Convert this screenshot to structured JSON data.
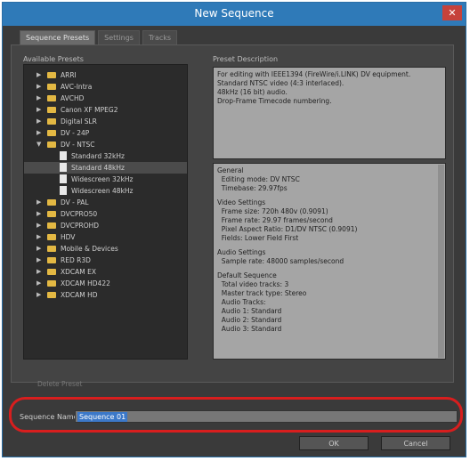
{
  "window": {
    "title": "New Sequence",
    "close_glyph": "✕"
  },
  "tabs": [
    {
      "label": "Sequence Presets",
      "active": true
    },
    {
      "label": "Settings",
      "active": false
    },
    {
      "label": "Tracks",
      "active": false
    }
  ],
  "presets": {
    "label": "Available Presets",
    "items": [
      {
        "label": "ARRI",
        "kind": "folder",
        "expanded": false,
        "depth": 0
      },
      {
        "label": "AVC-Intra",
        "kind": "folder",
        "expanded": false,
        "depth": 0
      },
      {
        "label": "AVCHD",
        "kind": "folder",
        "expanded": false,
        "depth": 0
      },
      {
        "label": "Canon XF MPEG2",
        "kind": "folder",
        "expanded": false,
        "depth": 0
      },
      {
        "label": "Digital SLR",
        "kind": "folder",
        "expanded": false,
        "depth": 0
      },
      {
        "label": "DV - 24P",
        "kind": "folder",
        "expanded": false,
        "depth": 0
      },
      {
        "label": "DV - NTSC",
        "kind": "folder",
        "expanded": true,
        "depth": 0
      },
      {
        "label": "Standard 32kHz",
        "kind": "file",
        "depth": 1
      },
      {
        "label": "Standard 48kHz",
        "kind": "file",
        "depth": 1,
        "selected": true
      },
      {
        "label": "Widescreen 32kHz",
        "kind": "file",
        "depth": 1
      },
      {
        "label": "Widescreen 48kHz",
        "kind": "file",
        "depth": 1
      },
      {
        "label": "DV - PAL",
        "kind": "folder",
        "expanded": false,
        "depth": 0
      },
      {
        "label": "DVCPRO50",
        "kind": "folder",
        "expanded": false,
        "depth": 0
      },
      {
        "label": "DVCPROHD",
        "kind": "folder",
        "expanded": false,
        "depth": 0
      },
      {
        "label": "HDV",
        "kind": "folder",
        "expanded": false,
        "depth": 0
      },
      {
        "label": "Mobile & Devices",
        "kind": "folder",
        "expanded": false,
        "depth": 0
      },
      {
        "label": "RED R3D",
        "kind": "folder",
        "expanded": false,
        "depth": 0
      },
      {
        "label": "XDCAM EX",
        "kind": "folder",
        "expanded": false,
        "depth": 0
      },
      {
        "label": "XDCAM HD422",
        "kind": "folder",
        "expanded": false,
        "depth": 0
      },
      {
        "label": "XDCAM HD",
        "kind": "folder",
        "expanded": false,
        "depth": 0
      }
    ]
  },
  "description": {
    "label": "Preset Description",
    "summary_lines": [
      "For editing with IEEE1394 (FireWire/i.LINK) DV equipment.",
      "Standard NTSC video (4:3 interlaced).",
      "48kHz (16 bit) audio.",
      "Drop-Frame Timecode numbering."
    ],
    "detail_lines": [
      {
        "text": "General",
        "gap": false
      },
      {
        "text": "  Editing mode: DV NTSC",
        "gap": false
      },
      {
        "text": "  Timebase: 29.97fps",
        "gap": false
      },
      {
        "text": "Video Settings",
        "gap": true
      },
      {
        "text": "  Frame size: 720h 480v (0.9091)",
        "gap": false
      },
      {
        "text": "  Frame rate: 29.97 frames/second",
        "gap": false
      },
      {
        "text": "  Pixel Aspect Ratio: D1/DV NTSC (0.9091)",
        "gap": false
      },
      {
        "text": "  Fields: Lower Field First",
        "gap": false
      },
      {
        "text": "Audio Settings",
        "gap": true
      },
      {
        "text": "  Sample rate: 48000 samples/second",
        "gap": false
      },
      {
        "text": "Default Sequence",
        "gap": true
      },
      {
        "text": "  Total video tracks: 3",
        "gap": false
      },
      {
        "text": "  Master track type: Stereo",
        "gap": false
      },
      {
        "text": "  Audio Tracks:",
        "gap": false
      },
      {
        "text": "  Audio 1: Standard",
        "gap": false
      },
      {
        "text": "  Audio 2: Standard",
        "gap": false
      },
      {
        "text": "  Audio 3: Standard",
        "gap": false
      }
    ]
  },
  "delete_preset_label": "Delete Preset",
  "sequence_name": {
    "label": "Sequence Name:",
    "value": "Sequence 01"
  },
  "buttons": {
    "ok": "OK",
    "cancel": "Cancel"
  },
  "colors": {
    "title_bar": "#2f7ab8",
    "highlight_ring": "#d81e1e",
    "folder": "#e3b843",
    "selection": "#3c78c8"
  }
}
